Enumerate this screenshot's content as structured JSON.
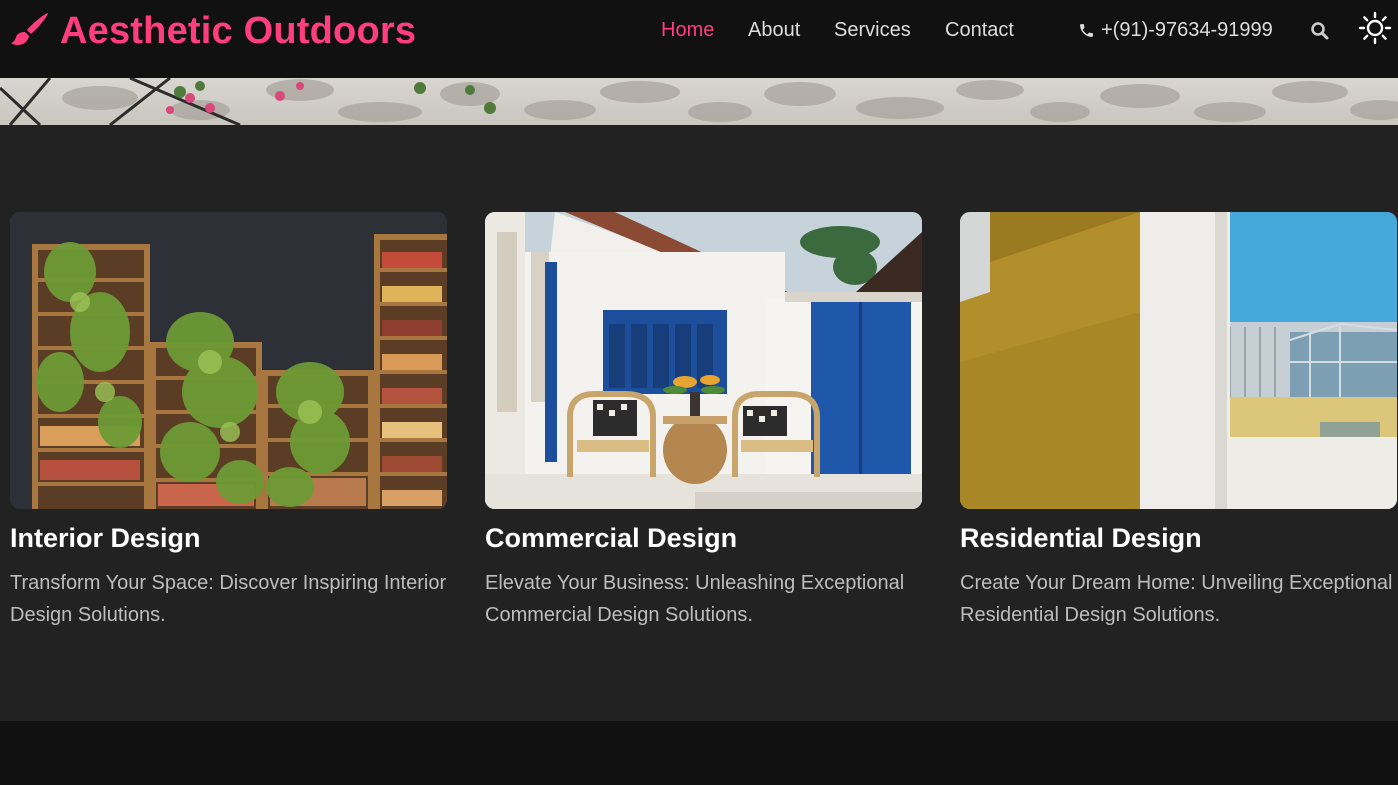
{
  "brand": {
    "name": "Aesthetic Outdoors",
    "logo_icon": "paint-brush-icon",
    "accent": "#ff3d7f"
  },
  "nav": {
    "items": [
      {
        "label": "Home",
        "active": true
      },
      {
        "label": "About",
        "active": false
      },
      {
        "label": "Services",
        "active": false
      },
      {
        "label": "Contact",
        "active": false
      }
    ]
  },
  "contact": {
    "phone": "+(91)-97634-91999",
    "phone_icon": "phone-icon"
  },
  "header_icons": {
    "search": "search-icon",
    "theme_toggle": "sun-icon"
  },
  "services": [
    {
      "title": "Interior Design",
      "description": "Transform Your Space: Discover Inspiring Interior Design Solutions.",
      "image": "bookshelves-with-plants"
    },
    {
      "title": "Commercial Design",
      "description": "Elevate Your Business: Unleashing Exceptional Commercial Design Solutions.",
      "image": "white-house-blue-doors-rattan-chairs"
    },
    {
      "title": "Residential Design",
      "description": "Create Your Dream Home: Unveiling Exceptional Residential Design Solutions.",
      "image": "modern-building-facade"
    }
  ],
  "colors": {
    "header_bg": "#111111",
    "page_bg": "#222222",
    "text_muted": "#bdbdbd"
  }
}
